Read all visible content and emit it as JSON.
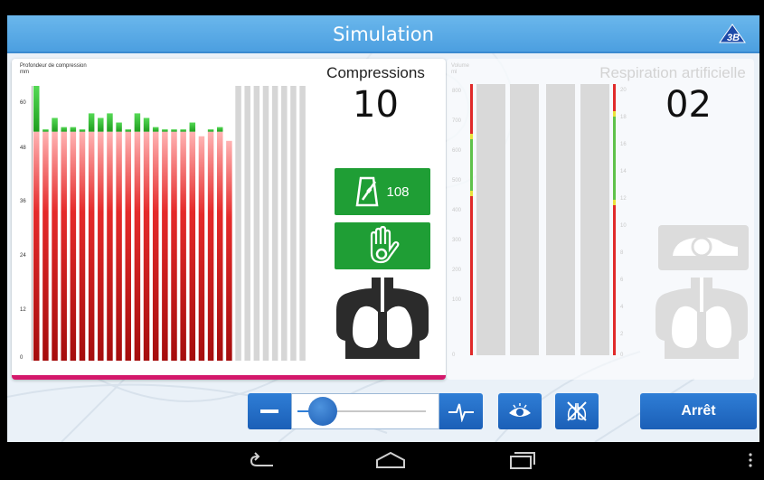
{
  "header": {
    "title": "Simulation"
  },
  "compression_panel": {
    "axis_title_line1": "Profondeur de compression",
    "axis_title_line2": "mm",
    "y_ticks": [
      "60",
      "48",
      "36",
      "24",
      "12",
      "0"
    ],
    "label": "Compressions",
    "count": "10",
    "metronome_rate": "108",
    "chart_data": {
      "type": "bar",
      "title": "",
      "ylabel": "Profondeur de compression mm",
      "ylim": [
        0,
        60
      ],
      "target_depth": 50,
      "colors": {
        "above_target": "#33bb33",
        "below_target": "#d41a1a",
        "empty": "#d6d6d6"
      },
      "total_slots": 30,
      "values": [
        60,
        50.5,
        53,
        51,
        51,
        50.5,
        54,
        53,
        54,
        52,
        50.5,
        54,
        53,
        51,
        50.5,
        50.5,
        50.5,
        52,
        49,
        50.5,
        51,
        48,
        0,
        0,
        0,
        0,
        0,
        0,
        0,
        0
      ]
    }
  },
  "ventilation_panel": {
    "label": "Respiration artificielle",
    "count": "02",
    "left_axis_title": "Volume\nml",
    "left_ticks": [
      "800",
      "700",
      "600",
      "500",
      "400",
      "300",
      "200",
      "100",
      "0"
    ],
    "right_ticks": [
      "20",
      "18",
      "16",
      "14",
      "12",
      "10",
      "8",
      "6",
      "4",
      "2",
      "0"
    ]
  },
  "controls": {
    "minus_icon": "minus-icon",
    "pulse_icon": "heartbeat-icon",
    "eye_icon": "eye-icon",
    "lungs_icon": "lungs-crossed-icon",
    "slider_level": 0.1,
    "stop_label": "Arrêt"
  },
  "colors": {
    "accent_blue": "#2f7ed6",
    "title_blue": "#5aaae6",
    "green_button": "#1f9e35",
    "target_line": "#d4186b"
  }
}
